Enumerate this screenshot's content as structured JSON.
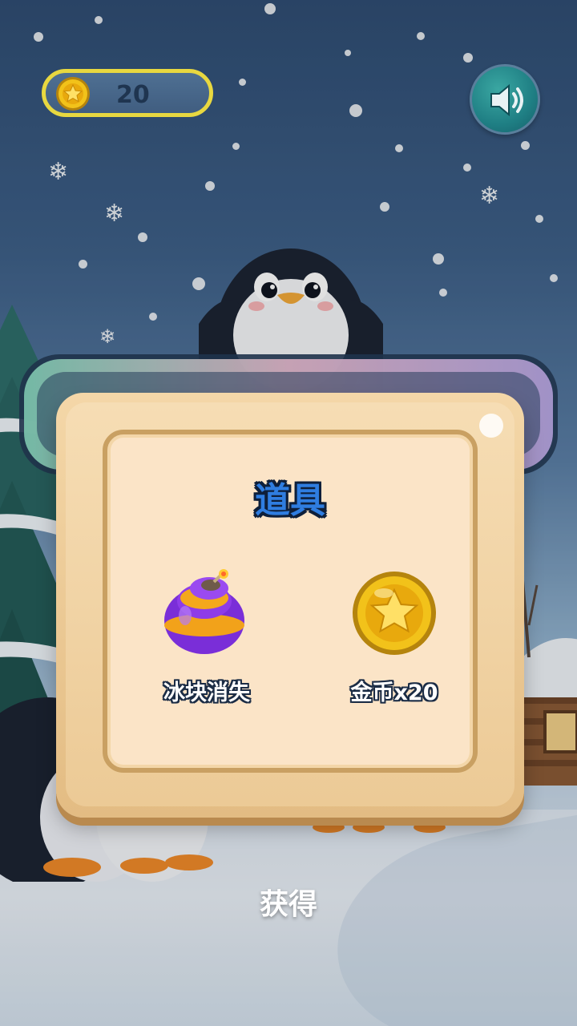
{
  "hud": {
    "coin_count": "20",
    "coin_icon": "gold-star-coin-icon",
    "sound_icon": "speaker-icon"
  },
  "background": {
    "title_icon": "game-title-logo",
    "mascot_icon": "penguin-icon"
  },
  "modal": {
    "title": "道具",
    "items": [
      {
        "label": "冰块消失",
        "icon": "purple-bomb-icon"
      },
      {
        "label": "金币x20",
        "icon": "gold-star-coin-icon"
      }
    ]
  },
  "actions": {
    "obtain_label": "获得"
  },
  "colors": {
    "title_blue": "#2f7de0",
    "coin_gold": "#f2c21a",
    "modal_frame": "#e3bc83",
    "modal_panel": "#fbe4c7",
    "pill_border": "#e8d840"
  }
}
